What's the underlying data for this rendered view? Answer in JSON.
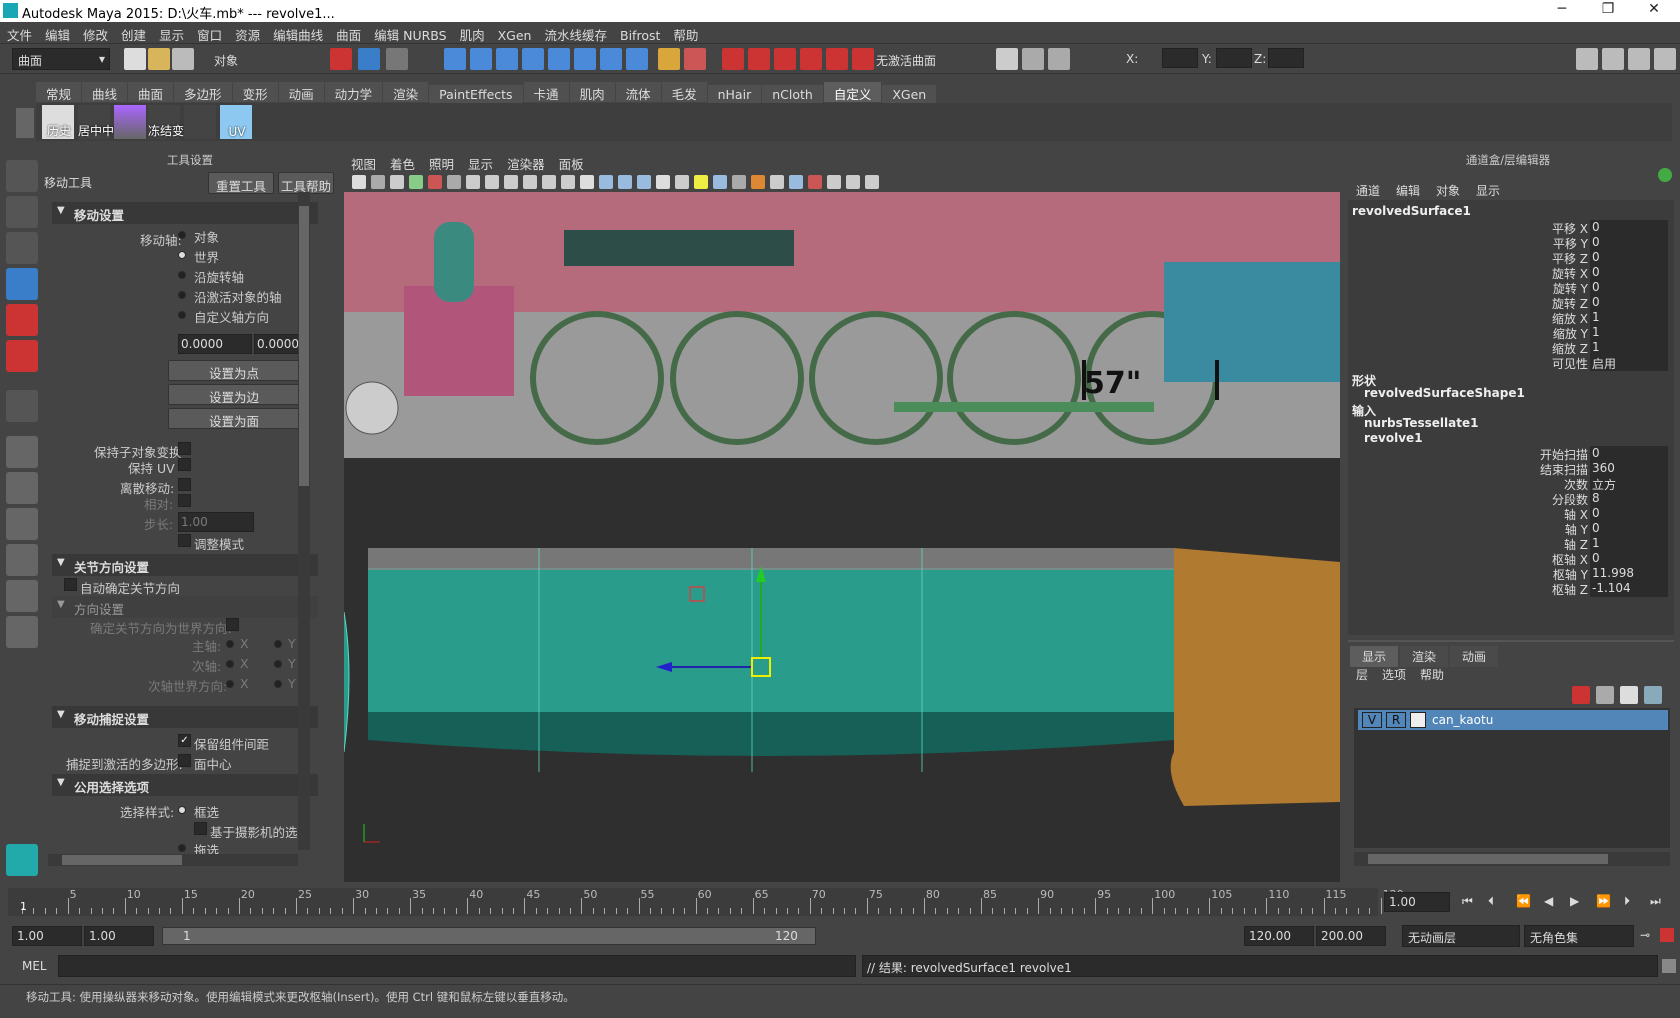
{
  "window": {
    "title": "Autodesk Maya 2015: D:\\火车.mb*   ---   revolve1..."
  },
  "menubar": [
    "文件",
    "编辑",
    "修改",
    "创建",
    "显示",
    "窗口",
    "资源",
    "编辑曲线",
    "曲面",
    "编辑 NURBS",
    "肌肉",
    "XGen",
    "流水线缓存",
    "Bifrost",
    "帮助"
  ],
  "statusline": {
    "mode": "曲面",
    "select_mode": "对象",
    "live_surface": "无激活曲面",
    "x_label": "X:",
    "y_label": "Y:",
    "z_label": "Z:"
  },
  "shelf": {
    "tabs": [
      "常规",
      "曲线",
      "曲面",
      "多边形",
      "变形",
      "动画",
      "动力学",
      "渲染",
      "PaintEffects",
      "卡通",
      "肌肉",
      "流体",
      "毛发",
      "nHair",
      "nCloth",
      "自定义",
      "XGen"
    ],
    "active_tab": "自定义",
    "icons": [
      "历史",
      "居中中",
      "",
      "冻结变",
      "",
      "UV"
    ]
  },
  "tool_settings": {
    "title": "工具设置",
    "tool_name": "移动工具",
    "reset_btn": "重置工具",
    "help_btn": "工具帮助",
    "move_settings": "移动设置",
    "move_axis_label": "移动轴:",
    "axes": [
      "对象",
      "世界",
      "沿旋转轴",
      "沿激活对象的轴",
      "自定义轴方向"
    ],
    "selected_axis": "世界",
    "field1": "0.0000",
    "field2": "0.0000",
    "set_point": "设置为点",
    "set_edge": "设置为边",
    "set_face": "设置为面",
    "keep_child": "保持子对象变换",
    "keep_uv": "保持 UV",
    "discrete_move": "离散移动:",
    "relative": "相对:",
    "step": "步长:",
    "step_val": "1.00",
    "tweak_mode": "调整模式",
    "joint_orient": "关节方向设置",
    "auto_orient": "自动确定关节方向",
    "orient_settings": "方向设置",
    "orient_world": "确定关节方向为世界方向:",
    "primary": "主轴:",
    "secondary": "次轴:",
    "secondary_world": "次轴世界方向:",
    "x": "X",
    "y": "Y",
    "snap_settings": "移动捕捉设置",
    "retain_spacing": "保留组件间距",
    "snap_live": "捕捉到激活的多边形:",
    "face_center": "面中心",
    "common_select": "公用选择选项",
    "select_style": "选择样式:",
    "marquee": "框选",
    "camera_based": "基于摄影机的选择",
    "drag": "拖选"
  },
  "viewport": {
    "menu": [
      "视图",
      "着色",
      "照明",
      "显示",
      "渲染器",
      "面板"
    ],
    "measure": "57\""
  },
  "channel_box": {
    "title": "通道盒/层编辑器",
    "menu": [
      "通道",
      "编辑",
      "对象",
      "显示"
    ],
    "object": "revolvedSurface1",
    "attrs": [
      [
        "平移 X",
        "0"
      ],
      [
        "平移 Y",
        "0"
      ],
      [
        "平移 Z",
        "0"
      ],
      [
        "旋转 X",
        "0"
      ],
      [
        "旋转 Y",
        "0"
      ],
      [
        "旋转 Z",
        "0"
      ],
      [
        "缩放 X",
        "1"
      ],
      [
        "缩放 Y",
        "1"
      ],
      [
        "缩放 Z",
        "1"
      ],
      [
        "可见性",
        "启用"
      ]
    ],
    "shape_label": "形状",
    "shape": "revolvedSurfaceShape1",
    "input_label": "输入",
    "input1": "nurbsTessellate1",
    "input2": "revolve1",
    "revolve_attrs": [
      [
        "开始扫描",
        "0"
      ],
      [
        "结束扫描",
        "360"
      ],
      [
        "次数",
        "立方"
      ],
      [
        "分段数",
        "8"
      ],
      [
        "轴 X",
        "0"
      ],
      [
        "轴 Y",
        "0"
      ],
      [
        "轴 Z",
        "1"
      ],
      [
        "枢轴 X",
        "0"
      ],
      [
        "枢轴 Y",
        "11.998"
      ],
      [
        "枢轴 Z",
        "-1.104"
      ]
    ],
    "layer_tabs": [
      "显示",
      "渲染",
      "动画"
    ],
    "layer_menu": [
      "层",
      "选项",
      "帮助"
    ],
    "layer": {
      "v": "V",
      "r": "R",
      "name": "can_kaotu"
    }
  },
  "timeline": {
    "ticks": [
      "5",
      "10",
      "15",
      "20",
      "25",
      "30",
      "35",
      "40",
      "45",
      "50",
      "55",
      "60",
      "65",
      "70",
      "75",
      "80",
      "85",
      "90",
      "95",
      "100",
      "105",
      "110",
      "115",
      "120"
    ],
    "current": "1",
    "current_field": "1.00"
  },
  "range": {
    "start": "1.00",
    "inner_start": "1.00",
    "slider_start": "1",
    "slider_end": "120",
    "end": "120.00",
    "outer_end": "200.00",
    "anim_layer": "无动画层",
    "char_set": "无角色集"
  },
  "cmd": {
    "label": "MEL",
    "result": "// 结果: revolvedSurface1 revolve1"
  },
  "help": {
    "text": "移动工具: 使用操纵器来移动对象。使用编辑模式来更改枢轴(Insert)。使用 Ctrl 键和鼠标左键以垂直移动。"
  }
}
